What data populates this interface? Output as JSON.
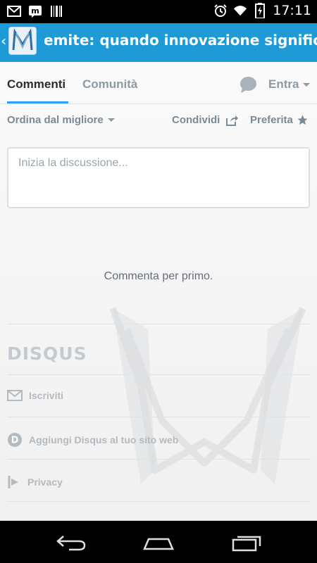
{
  "status_bar": {
    "time": "17:11",
    "left_icons": [
      "gmail-icon",
      "messaging-icon",
      "barcode-icon"
    ],
    "right_icons": [
      "alarm-icon",
      "wifi-icon",
      "battery-charging-icon"
    ]
  },
  "action_bar": {
    "title": "emite: quando innovazione significa anche",
    "icons": [
      "back-chevron-icon",
      "app-logo-icon"
    ]
  },
  "tabs": {
    "comments": "Commenti",
    "community": "Comunità",
    "login": "Entra",
    "active": "comments"
  },
  "subbar": {
    "sort": "Ordina dal migliore",
    "share": "Condividi",
    "favorite": "Preferita"
  },
  "comment_box": {
    "placeholder": "Inizia la discussione..."
  },
  "empty_message": "Commenta per primo.",
  "footer": {
    "brand": "DISQUS",
    "links": [
      {
        "label": "Iscriviti",
        "icon": "mail-icon"
      },
      {
        "label": "Aggiungi Disqus al tuo sito web",
        "icon": "disqus-d-icon"
      },
      {
        "label": "Privacy",
        "icon": "privacy-icon"
      }
    ]
  },
  "colors": {
    "action_bar": "#1e9ad6",
    "accent": "#2e9fff",
    "muted_text": "#8c9aa3"
  },
  "nav_bar": {
    "icons": [
      "back-icon",
      "home-icon",
      "recent-apps-icon"
    ]
  }
}
